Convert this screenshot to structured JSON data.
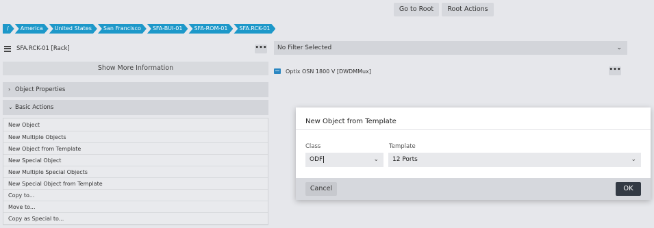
{
  "header": {
    "go_to_root": "Go to Root",
    "root_actions": "Root Actions"
  },
  "breadcrumb": [
    "/",
    "America",
    "United States",
    "San Francisco",
    "SFA-BUI-01",
    "SFA-ROM-01",
    "SFA.RCK-01"
  ],
  "left_panel": {
    "rack_label": "SFA.RCK-01 [Rack]",
    "more_button": "•••",
    "show_more": "Show More Information",
    "object_properties": "Object Properties",
    "basic_actions": "Basic Actions",
    "actions": [
      "New Object",
      "New Multiple Objects",
      "New Object from Template",
      "New Special Object",
      "New Multiple Special Objects",
      "New Special Object from Template",
      "Copy to...",
      "Move to...",
      "Copy as Special to..."
    ]
  },
  "right_panel": {
    "filter": "No Filter Selected",
    "device_label": "Optix OSN 1800 V [DWDMMux]",
    "more_button": "•••"
  },
  "modal": {
    "title": "New Object from Template",
    "class_label": "Class",
    "class_value": "ODF",
    "template_label": "Template",
    "template_value": "12 Ports",
    "cancel": "Cancel",
    "ok": "OK"
  },
  "colors": {
    "breadcrumb": "#1d98c9",
    "ok_button": "#333a44",
    "device_icon": "#2a86c1"
  }
}
